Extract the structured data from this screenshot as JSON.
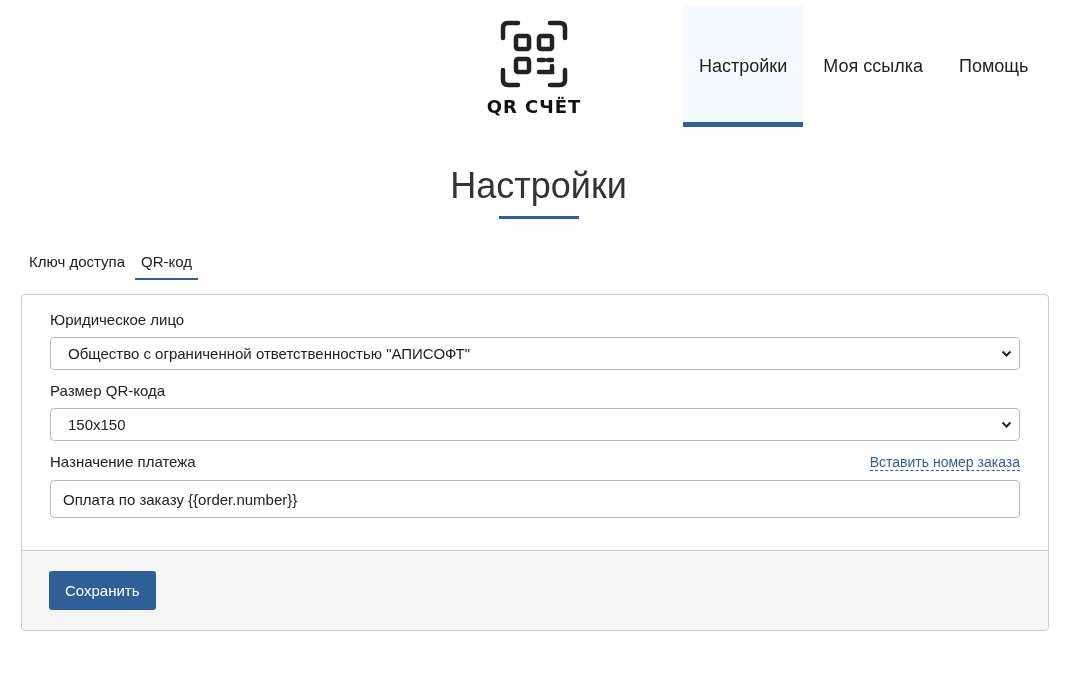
{
  "logo": {
    "text": "QR СЧЁТ"
  },
  "nav": [
    {
      "label": "Настройки",
      "selected": true
    },
    {
      "label": "Моя ссылка",
      "selected": false
    },
    {
      "label": "Помощь",
      "selected": false
    }
  ],
  "page_title": "Настройки",
  "tabs": [
    {
      "label": "Ключ доступа",
      "selected": false
    },
    {
      "label": "QR-код",
      "selected": true
    }
  ],
  "fields": [
    {
      "kind": "select",
      "label": "Юридическое лицо",
      "value": "Общество с ограниченной ответственностью \"АПИСОФТ\""
    },
    {
      "kind": "select",
      "label": "Размер QR-кода",
      "value": "150x150"
    },
    {
      "kind": "input",
      "label": "Назначение платежа",
      "link": "Вставить номер заказа",
      "value": "Оплата по заказу {{order.number}}"
    }
  ],
  "save_button": "Сохранить"
}
